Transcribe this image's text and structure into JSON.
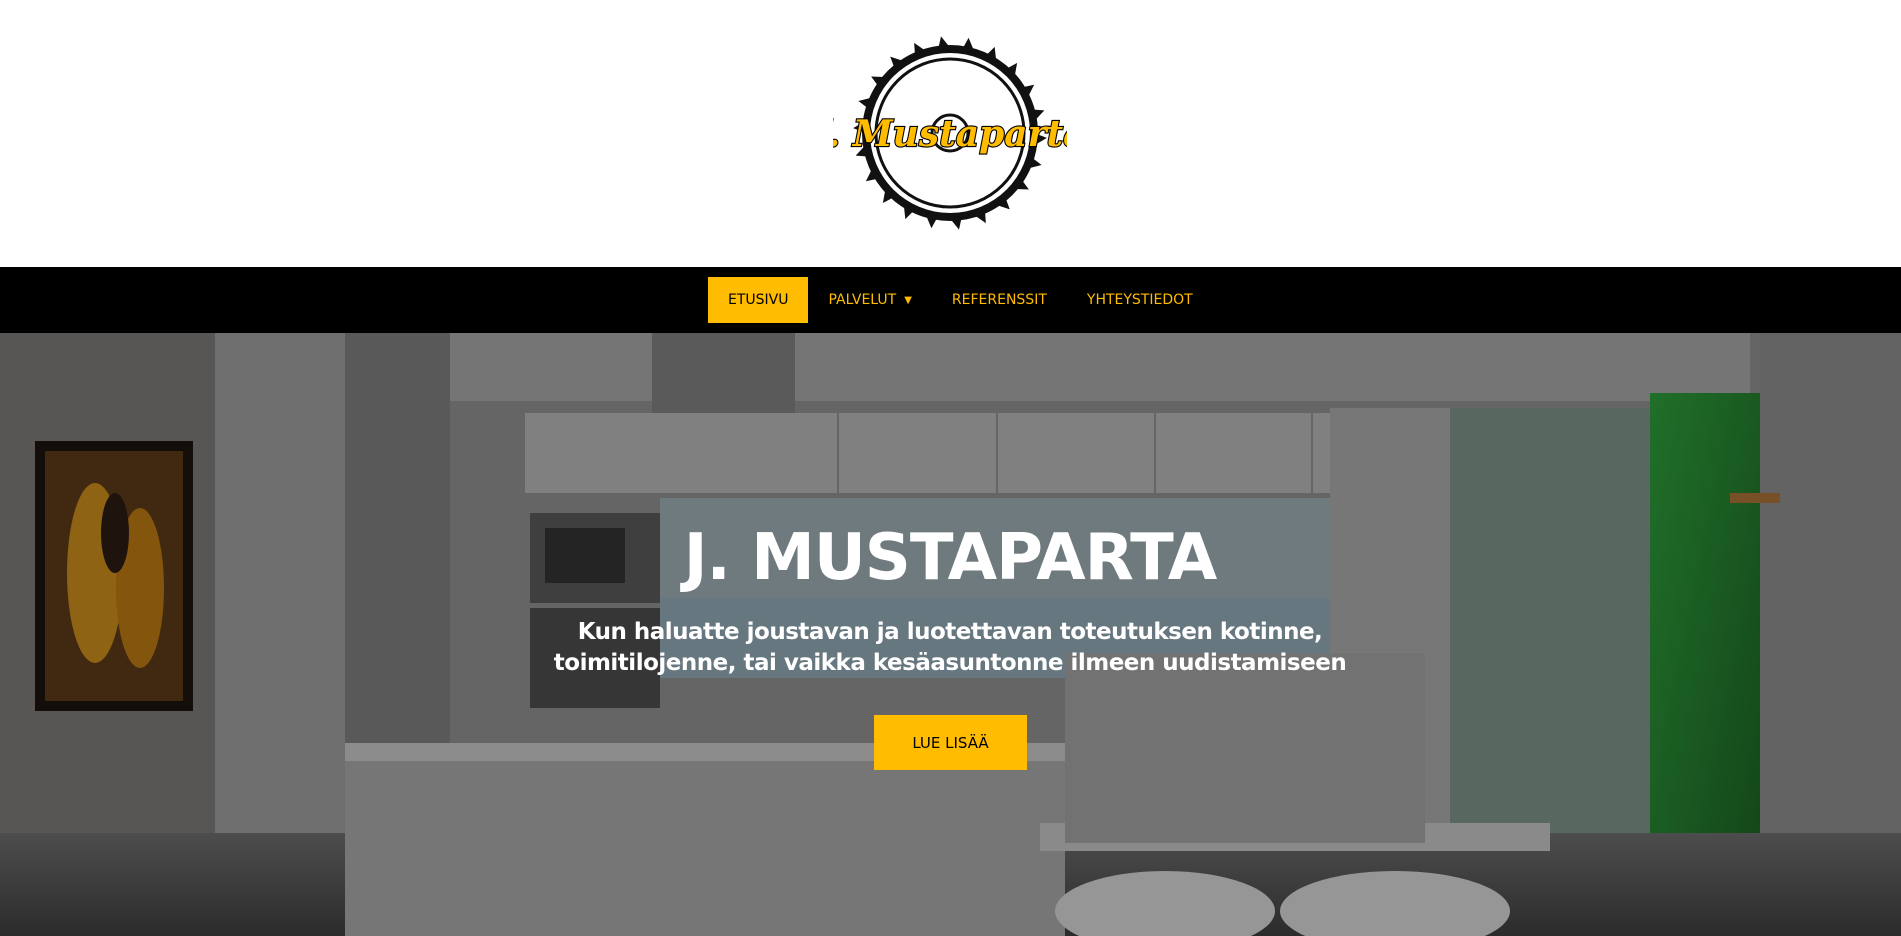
{
  "logo": {
    "text": "J. Mustaparta",
    "icon": "saw-blade-icon"
  },
  "nav": {
    "items": [
      {
        "label": "ETUSIVU",
        "active": true
      },
      {
        "label": "PALVELUT",
        "has_dropdown": true
      },
      {
        "label": "REFERENSSIT"
      },
      {
        "label": "YHTEYSTIEDOT"
      }
    ]
  },
  "hero": {
    "title": "J. MUSTAPARTA",
    "subtitle_line1": "Kun haluatte joustavan ja luotettavan toteutuksen kotinne,",
    "subtitle_line2": "toimitilojenne, tai vaikka kesäasuntonne ilmeen uudistamiseen",
    "button_label": "LUE LISÄÄ"
  },
  "colors": {
    "accent": "#ffbc00",
    "nav_bg": "#000000",
    "page_bg": "#ffffff"
  }
}
